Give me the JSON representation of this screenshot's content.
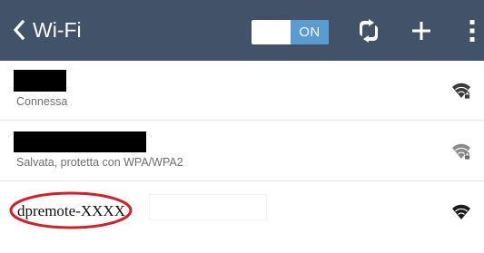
{
  "header": {
    "back_icon": "chevron-left-icon",
    "title": "Wi-Fi",
    "toggle_label": "ON",
    "actions": [
      "refresh-icon",
      "add-icon",
      "more-vert-icon"
    ],
    "color": "#425369",
    "toggle_color": "#5a9bd0"
  },
  "networks": [
    {
      "ssid_hidden": true,
      "status": "Connessa",
      "signal_icon": "wifi-lock-icon",
      "signal_color": "#3a3a3a"
    },
    {
      "ssid_hidden": true,
      "status": "Salvata, protetta con WPA/WPA2",
      "signal_icon": "wifi-lock-icon",
      "signal_color": "#8a8a8a"
    },
    {
      "ssid": "dpremote-XXXX",
      "signal_icon": "wifi-icon",
      "signal_color": "#1a1a1a",
      "highlight_color": "#d0202a"
    }
  ]
}
